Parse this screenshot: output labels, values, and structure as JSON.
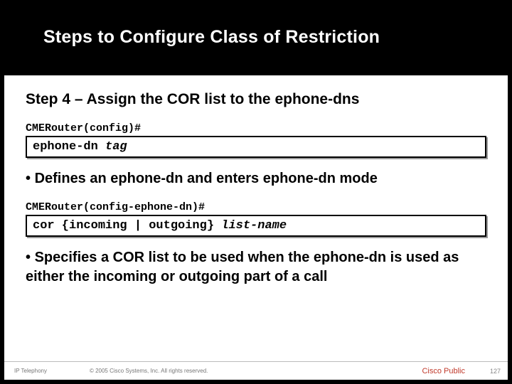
{
  "title": "Steps to Configure Class of Restriction",
  "step_heading": "Step 4 – Assign the COR list to the ephone-dns",
  "block1": {
    "prompt": "CMERouter(config)#",
    "cmd_kw": "ephone-dn ",
    "cmd_arg": "tag",
    "bullet": "Defines an ephone-dn and enters ephone-dn mode"
  },
  "block2": {
    "prompt": "CMERouter(config-ephone-dn)#",
    "cmd_kw": "cor {incoming | outgoing} ",
    "cmd_arg": "list-name",
    "bullet": "Specifies a COR list to be used when the ephone-dn is used as either the incoming or outgoing part of a call"
  },
  "footer": {
    "left": "IP Telephony",
    "center": "© 2005 Cisco Systems, Inc. All rights reserved.",
    "public": "Cisco Public",
    "page": "127"
  }
}
